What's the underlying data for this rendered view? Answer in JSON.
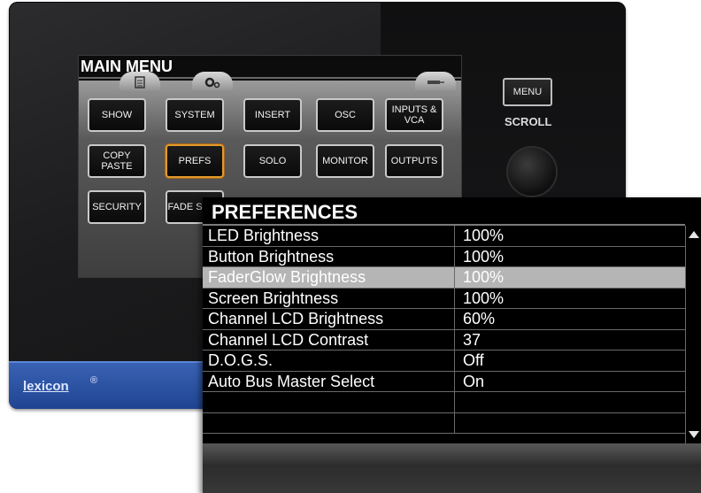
{
  "brand": {
    "logo": "lexicon",
    "reg": "®"
  },
  "main_menu": {
    "title": "MAIN MENU",
    "buttons": {
      "show": "SHOW",
      "system": "SYSTEM",
      "insert": "INSERT",
      "osc": "OSC",
      "inputs_vca": "INPUTS & VCA",
      "copy_paste": "COPY PASTE",
      "prefs": "PREFS",
      "solo": "SOLO",
      "monitor": "MONITOR",
      "outputs": "OUTPUTS",
      "security": "SECURITY",
      "fader_setup": "FADE SETU"
    }
  },
  "controls": {
    "menu_label": "MENU",
    "scroll_label": "SCROLL"
  },
  "preferences": {
    "title": "PREFERENCES",
    "selected_index": 2,
    "rows": [
      {
        "name": "LED Brightness",
        "value": "100%"
      },
      {
        "name": "Button Brightness",
        "value": "100%"
      },
      {
        "name": "FaderGlow Brightness",
        "value": "100%"
      },
      {
        "name": "Screen Brightness",
        "value": "100%"
      },
      {
        "name": "Channel LCD Brightness",
        "value": "60%"
      },
      {
        "name": "Channel LCD Contrast",
        "value": "37"
      },
      {
        "name": "D.O.G.S.",
        "value": "Off"
      },
      {
        "name": "Auto Bus Master Select",
        "value": "On"
      },
      {
        "name": "",
        "value": ""
      },
      {
        "name": "",
        "value": ""
      }
    ]
  },
  "colors": {
    "accent_selected": "#e29a2b",
    "brand_blue": "#2a52a3",
    "row_selected": "#b5b5b5"
  }
}
